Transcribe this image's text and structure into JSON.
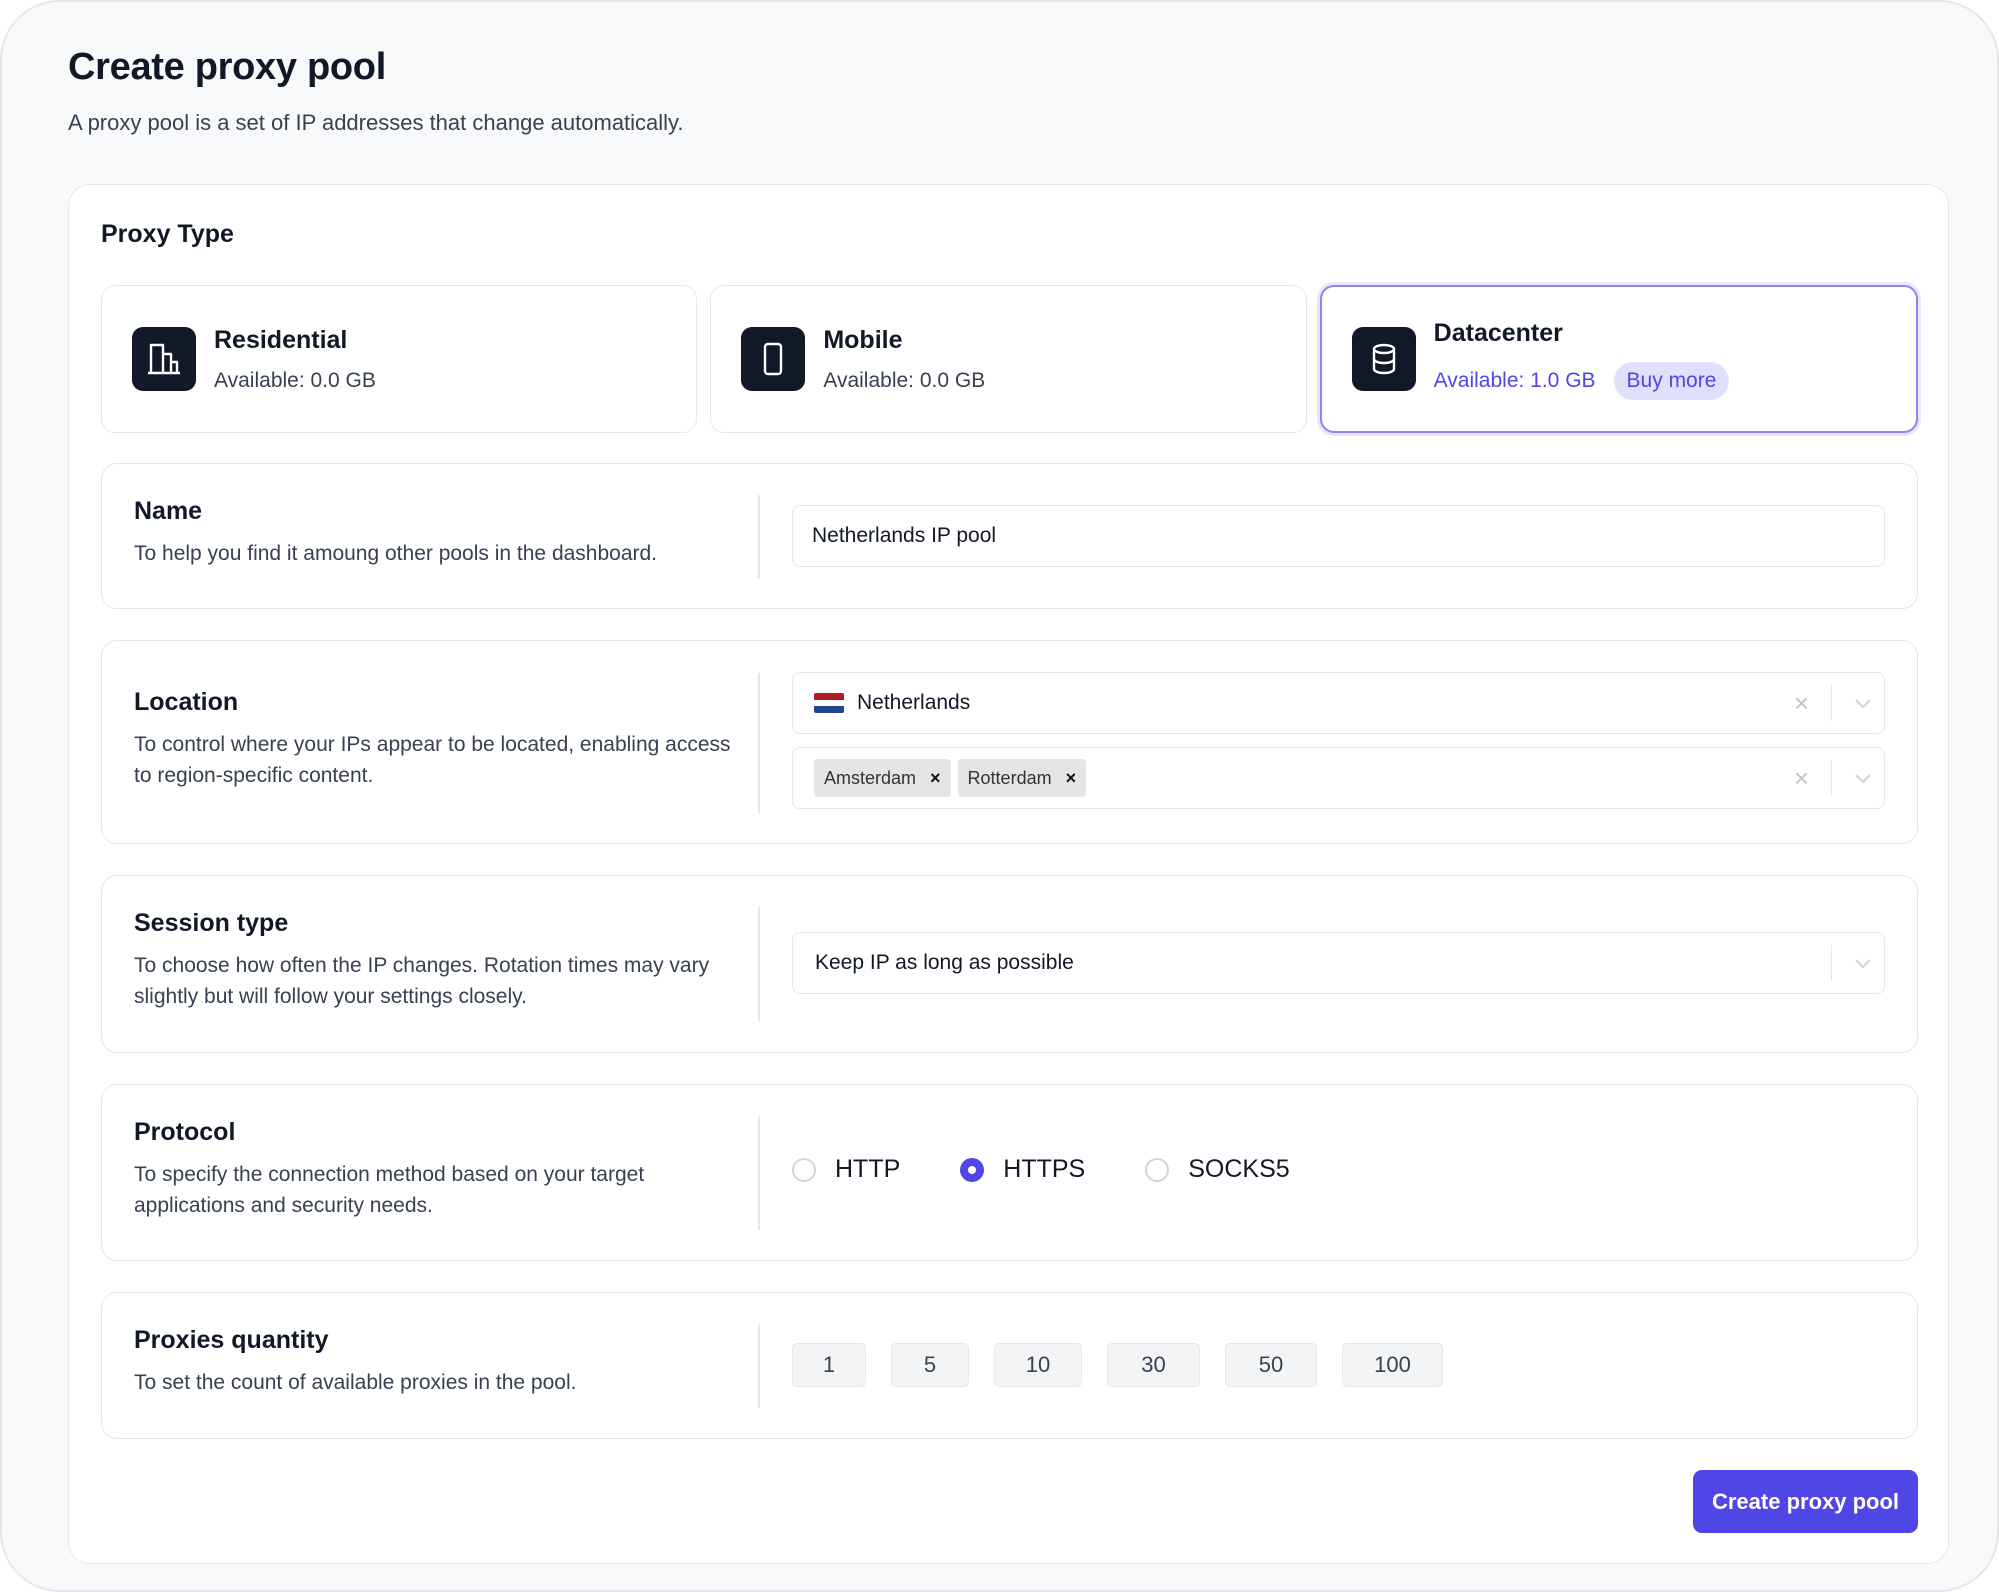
{
  "page": {
    "title": "Create proxy pool",
    "subtitle": "A proxy pool is a set of IP addresses that change automatically."
  },
  "proxy_type": {
    "label": "Proxy Type",
    "options": [
      {
        "name": "Residential",
        "available": "Available: 0.0 GB",
        "icon": "building-icon",
        "selected": false
      },
      {
        "name": "Mobile",
        "available": "Available: 0.0 GB",
        "icon": "smartphone-icon",
        "selected": false
      },
      {
        "name": "Datacenter",
        "available": "Available: 1.0 GB",
        "icon": "database-icon",
        "selected": true,
        "action": "Buy more"
      }
    ]
  },
  "name_section": {
    "title": "Name",
    "description": "To help you find it amoung other pools in the dashboard.",
    "value": "Netherlands IP pool"
  },
  "location_section": {
    "title": "Location",
    "description": "To control where your IPs appear to be located, enabling access to region-specific content.",
    "country": "Netherlands",
    "cities": [
      "Amsterdam",
      "Rotterdam"
    ],
    "clear_symbol": "×",
    "remove_symbol": "×"
  },
  "session_section": {
    "title": "Session type",
    "description": "To choose how often the IP changes. Rotation times may vary slightly but will follow your settings closely.",
    "value": "Keep IP as long as possible"
  },
  "protocol_section": {
    "title": "Protocol",
    "description": "To specify the connection method based on your target applications and security needs.",
    "options": [
      "HTTP",
      "HTTPS",
      "SOCKS5"
    ],
    "selected": "HTTPS"
  },
  "quantity_section": {
    "title": "Proxies quantity",
    "description": "To set the count of available proxies in the pool.",
    "options": [
      "1",
      "5",
      "10",
      "30",
      "50",
      "100"
    ]
  },
  "submit_label": "Create proxy pool",
  "colors": {
    "accent": "#4f46e5",
    "accent_light": "#e0e0fc",
    "icon_bg": "#111827",
    "border": "#e5e7eb",
    "flag_red": "#ae1c28",
    "flag_white": "#ffffff",
    "flag_blue": "#21468b"
  }
}
